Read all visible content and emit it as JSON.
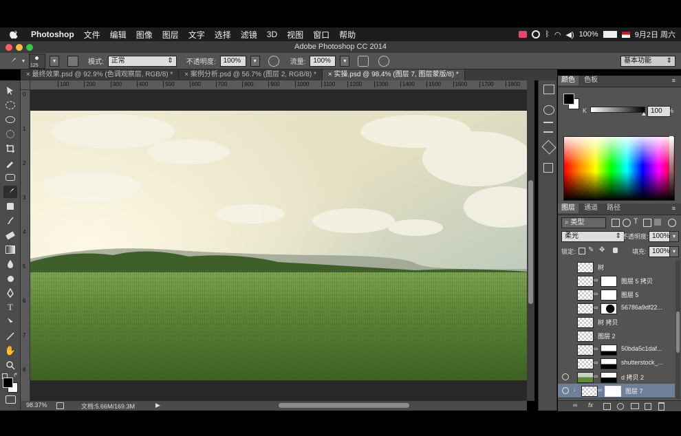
{
  "menubar": {
    "app_name": "Photoshop",
    "items": [
      "文件",
      "编辑",
      "图像",
      "图层",
      "文字",
      "选择",
      "滤镜",
      "3D",
      "视图",
      "窗口",
      "帮助"
    ],
    "battery": "100%",
    "date": "9月2日 周六"
  },
  "window": {
    "title": "Adobe Photoshop CC 2014"
  },
  "options_bar": {
    "brush_size": "125",
    "mode_label": "模式:",
    "mode_value": "正常",
    "opacity_label": "不透明度:",
    "opacity_value": "100%",
    "flow_label": "流量:",
    "flow_value": "100%",
    "workspace": "基本功能"
  },
  "tabs": [
    {
      "label": "最终效果.psd @ 92.9% (色调观察层, RGB/8) *"
    },
    {
      "label": "案例分析.psd @ 56.7% (图层 2, RGB/8) *"
    },
    {
      "label": "实操.psd @ 98.4% (图层 7, 图层蒙版/8) *"
    }
  ],
  "ruler": {
    "h_ticks": [
      "100",
      "200",
      "300",
      "400",
      "500",
      "600",
      "700",
      "800",
      "900",
      "1000",
      "1100",
      "1200",
      "1300",
      "1400",
      "1500",
      "1600",
      "1700",
      "1800"
    ],
    "v_ticks": [
      "0",
      "1",
      "2",
      "3",
      "4",
      "5",
      "6",
      "7",
      "8"
    ]
  },
  "status": {
    "zoom": "98.37%",
    "doc": "文档:5.66M/169.3M"
  },
  "color_panel": {
    "tabs": [
      "颜色",
      "色板"
    ],
    "channel": "K",
    "value": "100",
    "unit": "%",
    "slider_fraction": 1.0
  },
  "layers_panel": {
    "tabs": [
      "图层",
      "通道",
      "路径"
    ],
    "filter": "类型",
    "blend_mode": "柔光",
    "opacity_label": "不透明度:",
    "opacity": "100%",
    "lock_label": "锁定:",
    "fill_label": "填充:",
    "fill": "100%",
    "layers": [
      {
        "name": "树",
        "visible": false,
        "mask": false
      },
      {
        "name": "图层 5 拷贝",
        "visible": false,
        "mask": true
      },
      {
        "name": "图层 5",
        "visible": false,
        "mask": true
      },
      {
        "name": "56786a9df22...",
        "visible": false,
        "mask": true
      },
      {
        "name": "树 拷贝",
        "visible": false,
        "mask": false
      },
      {
        "name": "图层 2",
        "visible": false,
        "mask": false
      },
      {
        "name": "50bda5c1daf...",
        "visible": false,
        "mask": true
      },
      {
        "name": "shutterstock_...",
        "visible": false,
        "mask": true
      },
      {
        "name": "d 拷贝 2",
        "visible": true,
        "mask": true
      },
      {
        "name": "图层 7",
        "visible": true,
        "mask": true,
        "selected": true
      }
    ]
  },
  "icons": [
    "apple-icon",
    "brush-icon",
    "move-tool-icon",
    "eye-icon",
    "link-icon",
    "fx-icon",
    "new-layer-icon",
    "trash-icon"
  ]
}
